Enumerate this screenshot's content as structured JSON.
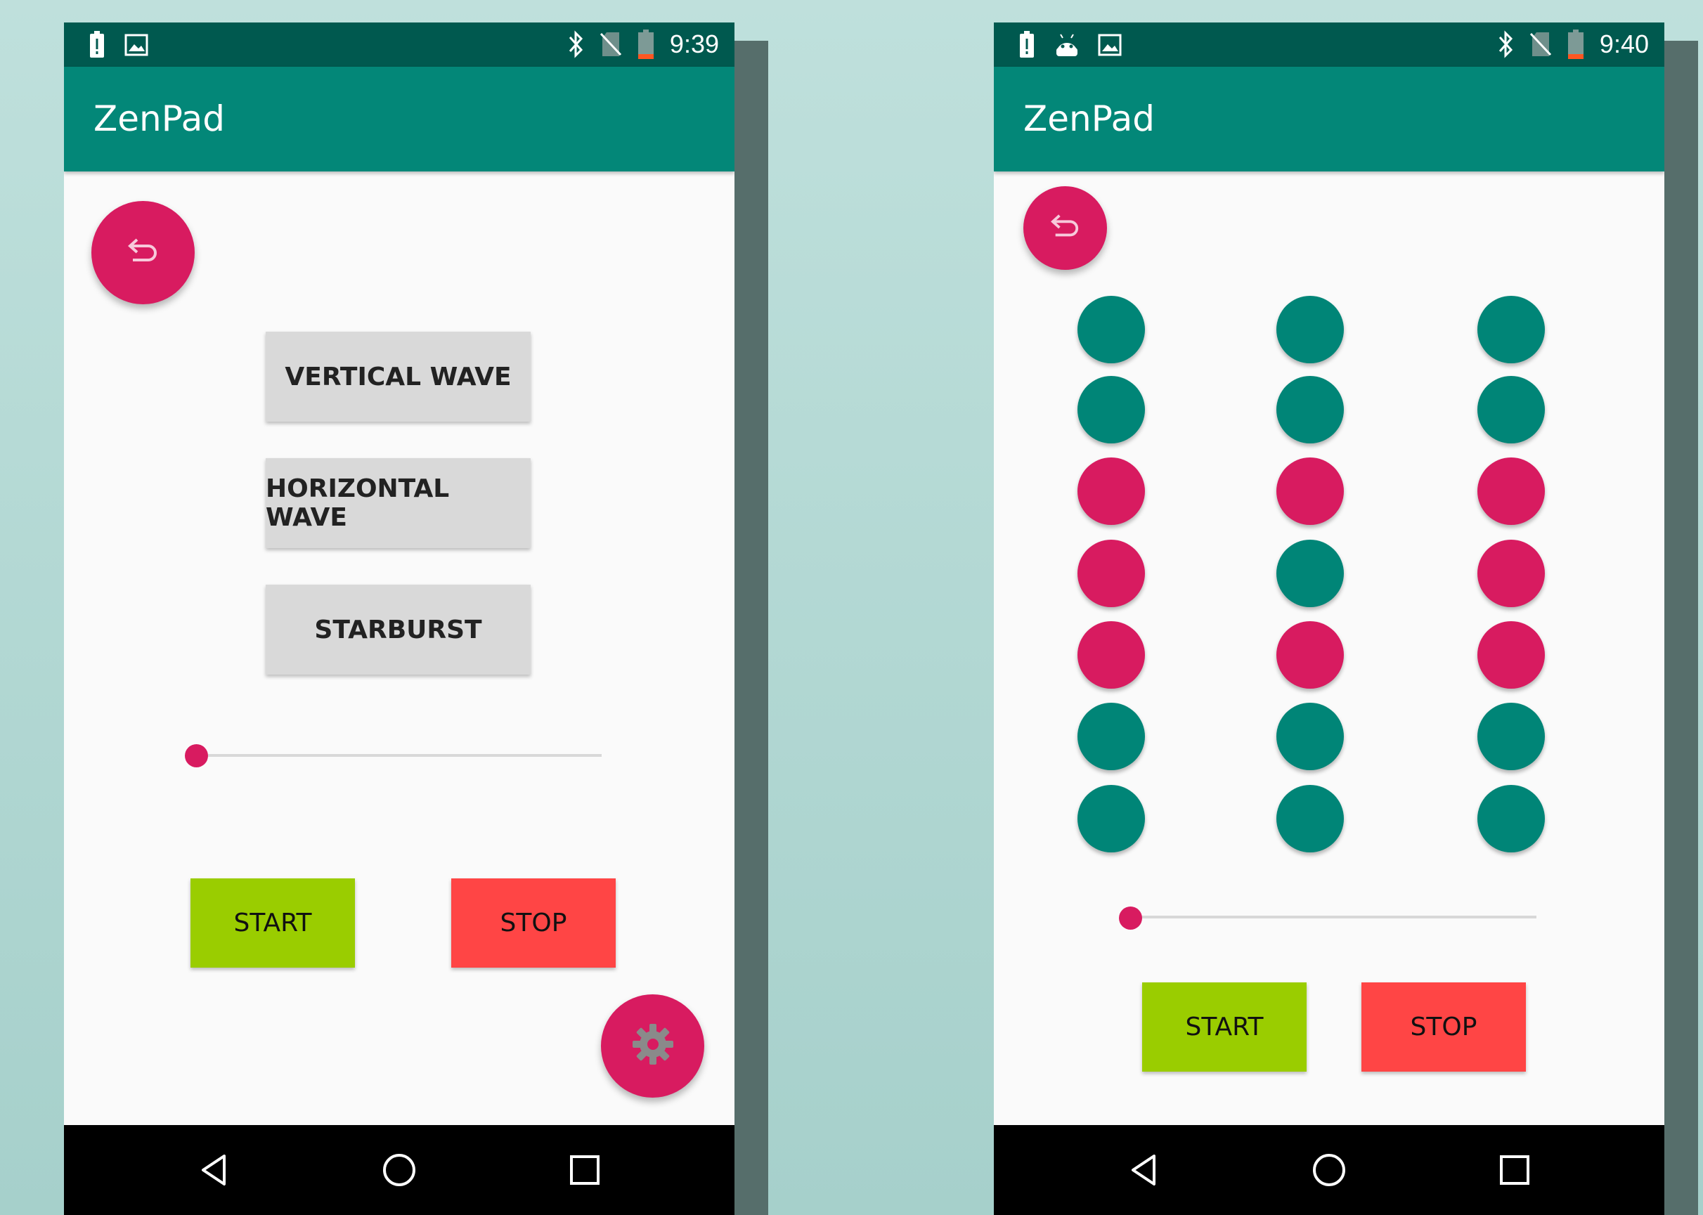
{
  "colors": {
    "status_bar": "#00594f",
    "app_bar": "#038778",
    "accent": "#d81b60",
    "teal_dot": "#008577",
    "pink_dot": "#d81b60",
    "start_button": "#9acd00",
    "stop_button": "#ff4545",
    "mode_button": "#d9d9d9"
  },
  "left_screen": {
    "status_bar": {
      "time": "9:39",
      "icons_left": [
        "alert-battery-icon",
        "image-icon"
      ],
      "icons_right": [
        "bluetooth-icon",
        "no-sim-icon",
        "battery-low-icon"
      ]
    },
    "app_title": "ZenPad",
    "undo_fab_icon": "undo-icon",
    "mode_buttons": [
      "VERTICAL WAVE",
      "HORIZONTAL WAVE",
      "STARBURST"
    ],
    "slider_value": 0,
    "start_label": "START",
    "stop_label": "STOP",
    "settings_fab_icon": "gear-icon",
    "nav": [
      "back-icon",
      "home-icon",
      "recents-icon"
    ]
  },
  "right_screen": {
    "status_bar": {
      "time": "9:40",
      "icons_left": [
        "alert-battery-icon",
        "android-icon",
        "image-icon"
      ],
      "icons_right": [
        "bluetooth-icon",
        "no-sim-icon",
        "battery-low-icon"
      ]
    },
    "app_title": "ZenPad",
    "undo_fab_icon": "undo-icon",
    "dot_grid": {
      "columns": [
        [
          "teal",
          "teal",
          "pink",
          "pink",
          "pink",
          "teal",
          "teal"
        ],
        [
          "teal",
          "teal",
          "pink",
          "teal",
          "pink",
          "teal",
          "teal"
        ],
        [
          "teal",
          "teal",
          "pink",
          "pink",
          "pink",
          "teal",
          "teal"
        ]
      ]
    },
    "slider_value": 0,
    "start_label": "START",
    "stop_label": "STOP",
    "nav": [
      "back-icon",
      "home-icon",
      "recents-icon"
    ]
  }
}
